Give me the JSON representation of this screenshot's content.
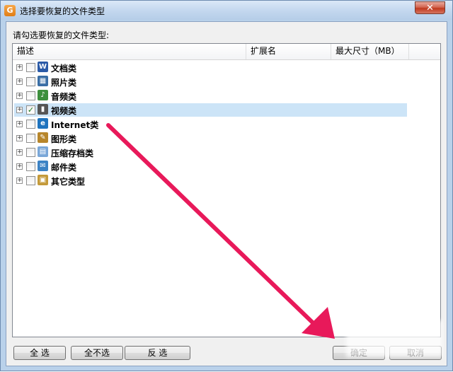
{
  "window": {
    "title": "选择要恢复的文件类型",
    "close_label": "✕",
    "icon_glyph": "G"
  },
  "prompt": "请勾选要恢复的文件类型:",
  "columns": [
    "描述",
    "扩展名",
    "最大尺寸（MB）"
  ],
  "items": [
    {
      "label": "文档类",
      "checked": false,
      "icon": "word-icon",
      "icon_glyph": "W",
      "color": "#2b5aa7"
    },
    {
      "label": "照片类",
      "checked": false,
      "icon": "photo-icon",
      "icon_glyph": "▦",
      "color": "#3a6ea5"
    },
    {
      "label": "音频类",
      "checked": false,
      "icon": "audio-icon",
      "icon_glyph": "♪",
      "color": "#3d8f3d"
    },
    {
      "label": "视频类",
      "checked": true,
      "icon": "video-icon",
      "icon_glyph": "▮",
      "color": "#555555"
    },
    {
      "label": "Internet类",
      "checked": false,
      "icon": "ie-icon",
      "icon_glyph": "e",
      "color": "#1e73be"
    },
    {
      "label": "图形类",
      "checked": false,
      "icon": "graphics-icon",
      "icon_glyph": "✎",
      "color": "#b7862b"
    },
    {
      "label": "压缩存档类",
      "checked": false,
      "icon": "archive-icon",
      "icon_glyph": "▤",
      "color": "#7aa7d8"
    },
    {
      "label": "邮件类",
      "checked": false,
      "icon": "mail-icon",
      "icon_glyph": "✉",
      "color": "#3b82c4"
    },
    {
      "label": "其它类型",
      "checked": false,
      "icon": "other-icon",
      "icon_glyph": "▣",
      "color": "#c49a3a"
    }
  ],
  "buttons": {
    "select_all": "全 选",
    "select_none": "全不选",
    "invert": "反 选",
    "ok": "确定",
    "cancel": "取消"
  },
  "selected_index": 3,
  "accent_color": "#e8195a"
}
